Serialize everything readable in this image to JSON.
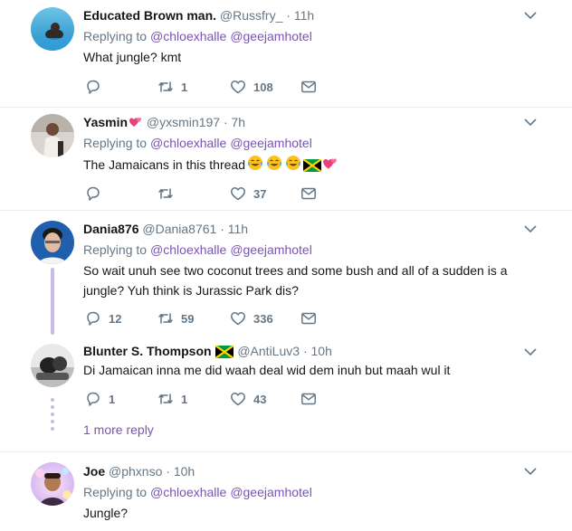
{
  "colors": {
    "accent": "#7855b0",
    "muted": "#657786",
    "divider": "#e6ecf0",
    "thread": "#cab9e6"
  },
  "tweets": [
    {
      "name": "Educated Brown man.",
      "handle": "@Russfry_",
      "time": "11h",
      "replying_label": "Replying to",
      "mentions": [
        "@chloexhalle",
        "@geejamhotel"
      ],
      "text": "What jungle? kmt",
      "replies": "",
      "retweets": "1",
      "likes": "108"
    },
    {
      "name": "Yasmin",
      "name_emoji": "two-hearts-emoji",
      "handle": "@yxsmin197",
      "time": "7h",
      "replying_label": "Replying to",
      "mentions": [
        "@chloexhalle",
        "@geejamhotel"
      ],
      "text": "The Jamaicans in this thread",
      "text_emojis": [
        "tears-of-joy-emoji",
        "tears-of-joy-emoji",
        "tears-of-joy-emoji",
        "jamaica-flag-emoji",
        "two-hearts-emoji"
      ],
      "replies": "",
      "retweets": "",
      "likes": "37"
    },
    {
      "name": "Dania876",
      "handle": "@Dania8761",
      "time": "11h",
      "replying_label": "Replying to",
      "mentions": [
        "@chloexhalle",
        "@geejamhotel"
      ],
      "text": "So wait unuh see two coconut trees and some bush and all of a sudden is a jungle? Yuh think is Jurassic Park dis?",
      "replies": "12",
      "retweets": "59",
      "likes": "336"
    },
    {
      "name": "Blunter S. Thompson",
      "name_emoji": "jamaica-flag-emoji",
      "handle": "@AntiLuv3",
      "time": "10h",
      "text": "Di Jamaican inna me did waah deal wid dem inuh but maah wul it",
      "replies": "1",
      "retweets": "1",
      "likes": "43"
    },
    {
      "name": "Joe",
      "handle": "@phxnso",
      "time": "10h",
      "replying_label": "Replying to",
      "mentions": [
        "@chloexhalle",
        "@geejamhotel"
      ],
      "text": "Jungle?"
    }
  ],
  "more_reply_label": "1 more reply",
  "separator": "·"
}
